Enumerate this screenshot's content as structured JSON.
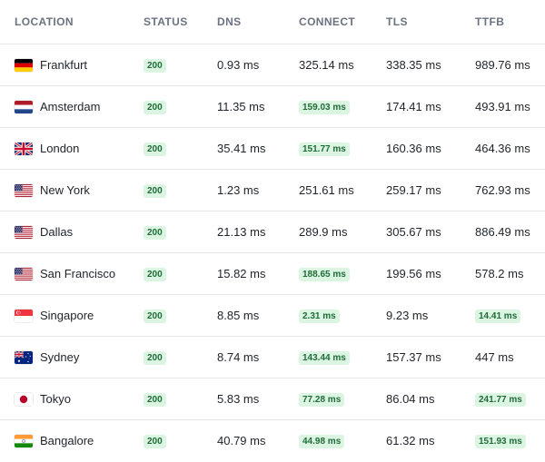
{
  "columns": [
    "LOCATION",
    "STATUS",
    "DNS",
    "CONNECT",
    "TLS",
    "TTFB"
  ],
  "colors": {
    "badge_bg": "#dcf5e3",
    "badge_text": "#1f6b38",
    "header_text": "#6b7280",
    "divider": "#e5e7eb"
  },
  "rows": [
    {
      "flag": "de-flag-icon",
      "location": "Frankfurt",
      "status": "200",
      "dns": "0.93 ms",
      "connect": "325.14 ms",
      "tls": "338.35 ms",
      "ttfb": "989.76 ms",
      "connect_highlight": false,
      "ttfb_highlight": false
    },
    {
      "flag": "nl-flag-icon",
      "location": "Amsterdam",
      "status": "200",
      "dns": "11.35 ms",
      "connect": "159.03 ms",
      "tls": "174.41 ms",
      "ttfb": "493.91 ms",
      "connect_highlight": true,
      "ttfb_highlight": false
    },
    {
      "flag": "gb-flag-icon",
      "location": "London",
      "status": "200",
      "dns": "35.41 ms",
      "connect": "151.77 ms",
      "tls": "160.36 ms",
      "ttfb": "464.36 ms",
      "connect_highlight": true,
      "ttfb_highlight": false
    },
    {
      "flag": "us-flag-icon",
      "location": "New York",
      "status": "200",
      "dns": "1.23 ms",
      "connect": "251.61 ms",
      "tls": "259.17 ms",
      "ttfb": "762.93 ms",
      "connect_highlight": false,
      "ttfb_highlight": false
    },
    {
      "flag": "us-flag-icon",
      "location": "Dallas",
      "status": "200",
      "dns": "21.13 ms",
      "connect": "289.9 ms",
      "tls": "305.67 ms",
      "ttfb": "886.49 ms",
      "connect_highlight": false,
      "ttfb_highlight": false
    },
    {
      "flag": "us-flag-icon",
      "location": "San Francisco",
      "status": "200",
      "dns": "15.82 ms",
      "connect": "188.65 ms",
      "tls": "199.56 ms",
      "ttfb": "578.2 ms",
      "connect_highlight": true,
      "ttfb_highlight": false
    },
    {
      "flag": "sg-flag-icon",
      "location": "Singapore",
      "status": "200",
      "dns": "8.85 ms",
      "connect": "2.31 ms",
      "tls": "9.23 ms",
      "ttfb": "14.41 ms",
      "connect_highlight": true,
      "ttfb_highlight": true
    },
    {
      "flag": "au-flag-icon",
      "location": "Sydney",
      "status": "200",
      "dns": "8.74 ms",
      "connect": "143.44 ms",
      "tls": "157.37 ms",
      "ttfb": "447 ms",
      "connect_highlight": true,
      "ttfb_highlight": false
    },
    {
      "flag": "jp-flag-icon",
      "location": "Tokyo",
      "status": "200",
      "dns": "5.83 ms",
      "connect": "77.28 ms",
      "tls": "86.04 ms",
      "ttfb": "241.77 ms",
      "connect_highlight": true,
      "ttfb_highlight": true
    },
    {
      "flag": "in-flag-icon",
      "location": "Bangalore",
      "status": "200",
      "dns": "40.79 ms",
      "connect": "44.98 ms",
      "tls": "61.32 ms",
      "ttfb": "151.93 ms",
      "connect_highlight": true,
      "ttfb_highlight": true
    }
  ]
}
